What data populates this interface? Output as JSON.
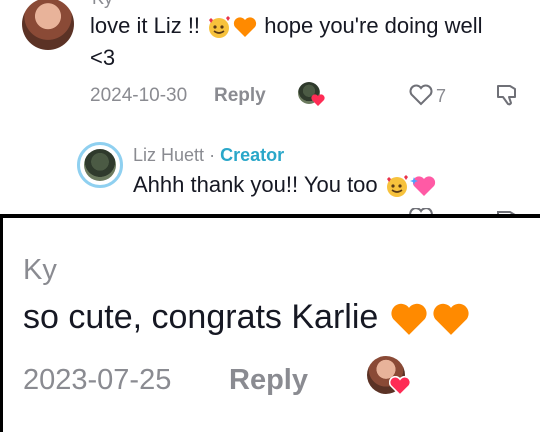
{
  "top_comment": {
    "username_cut": "Ky",
    "text_line1": "love it Liz !! ",
    "text_mid": " hope you're doing well",
    "text_line2": "<3",
    "date": "2024-10-30",
    "reply_label": "Reply",
    "like_count": "7"
  },
  "creator_reply": {
    "name": "Liz Huett",
    "separator": "·",
    "badge": "Creator",
    "text": "Ahhh thank you!! You too "
  },
  "bottom_comment": {
    "username": "Ky",
    "text": "so cute, congrats Karlie ",
    "date": "2023-07-25",
    "reply_label": "Reply"
  },
  "icons": [
    "avatar",
    "smiling-face-hearts-emoji",
    "orange-heart-emoji",
    "heart-outline-icon",
    "dislike-icon",
    "creator-liked-avatar",
    "heart-sparkle-emoji"
  ],
  "colors": {
    "accent": "#2aa7c9",
    "heart_badge": "#fe2c55",
    "orange_heart": "#ff8a00"
  }
}
